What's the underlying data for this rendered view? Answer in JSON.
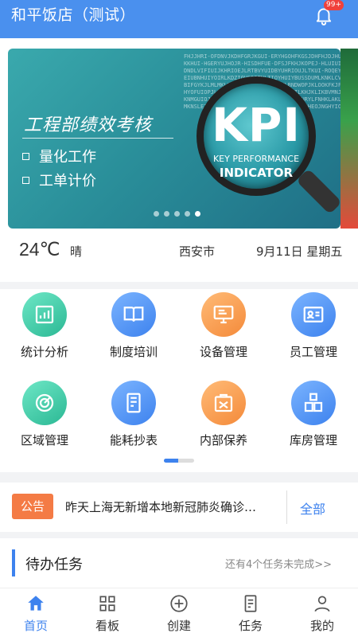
{
  "header": {
    "title": "和平饭店（测试）",
    "badge": "99+"
  },
  "banner": {
    "title": "工程部绩效考核",
    "items": [
      "量化工作",
      "工单计价"
    ],
    "kpi": "KPI",
    "kpi_line1": "KEY PERFORMANCE",
    "kpi_line2": "INDICATOR",
    "word_cloud": "FHJJHRI-OFDNVJKDHFGRJKGUI-ERYHGOHFKGSJDHFHJDJHUKKHUI-HGERYUJHOJR-HISDHFUE-DFSJFKHJKOPEJ-HLUIUIDNDLVIFIUIJKHRIOEJLRTBVYUIDBYUHRIOUJLTKUI-ROQEYEIUBNHUIYOIRLKDZIOVSDRTNLTIOYHUIYBUSSDUMLKNKLCVBIFGYKJLMLMKLKUEIOFWRIONVBOPJKLBNDWOPJKLOOKFKJFHYOFUIOPJLIUYUIUJKGDRRTYFJKYEGBNMILKHJKLIKBVMNJKNMGUIOJOPLUHJKCVBNSOPILDAJKLMKLLAYURYLFNHKLAKLMKNSLEIDIYDUFSDHFOUIEGTLJKLFLOLKJFGIOHEOJNGHYIOXMNBVYUBWEFUIIOLFVBJKINAKGHJ",
    "dots": 5,
    "active_dot": 4
  },
  "weather": {
    "temp": "24℃",
    "condition": "晴",
    "city": "西安市",
    "date": "9月11日 星期五"
  },
  "functions": [
    {
      "label": "统计分析",
      "icon": "chart-icon",
      "color": "green"
    },
    {
      "label": "制度培训",
      "icon": "book-icon",
      "color": "blue"
    },
    {
      "label": "设备管理",
      "icon": "monitor-icon",
      "color": "orange"
    },
    {
      "label": "员工管理",
      "icon": "id-card-icon",
      "color": "blue"
    },
    {
      "label": "区域管理",
      "icon": "radar-icon",
      "color": "green"
    },
    {
      "label": "能耗抄表",
      "icon": "meter-icon",
      "color": "blue"
    },
    {
      "label": "内部保养",
      "icon": "tools-icon",
      "color": "orange"
    },
    {
      "label": "库房管理",
      "icon": "boxes-icon",
      "color": "blue"
    }
  ],
  "notice": {
    "tag": "公告",
    "text": "昨天上海无新增本地新冠肺炎确诊…",
    "all": "全部"
  },
  "todo": {
    "title": "待办任务",
    "more": "还有4个任务未完成>>"
  },
  "tabs": [
    {
      "label": "首页",
      "icon": "home-icon"
    },
    {
      "label": "看板",
      "icon": "grid-icon"
    },
    {
      "label": "创建",
      "icon": "plus-circle-icon"
    },
    {
      "label": "任务",
      "icon": "task-icon"
    },
    {
      "label": "我的",
      "icon": "user-icon"
    }
  ],
  "colors": {
    "primary": "#4a90ee",
    "accent_blue": "#3d82ee",
    "orange": "#f47b45",
    "badge": "#f0413b"
  }
}
